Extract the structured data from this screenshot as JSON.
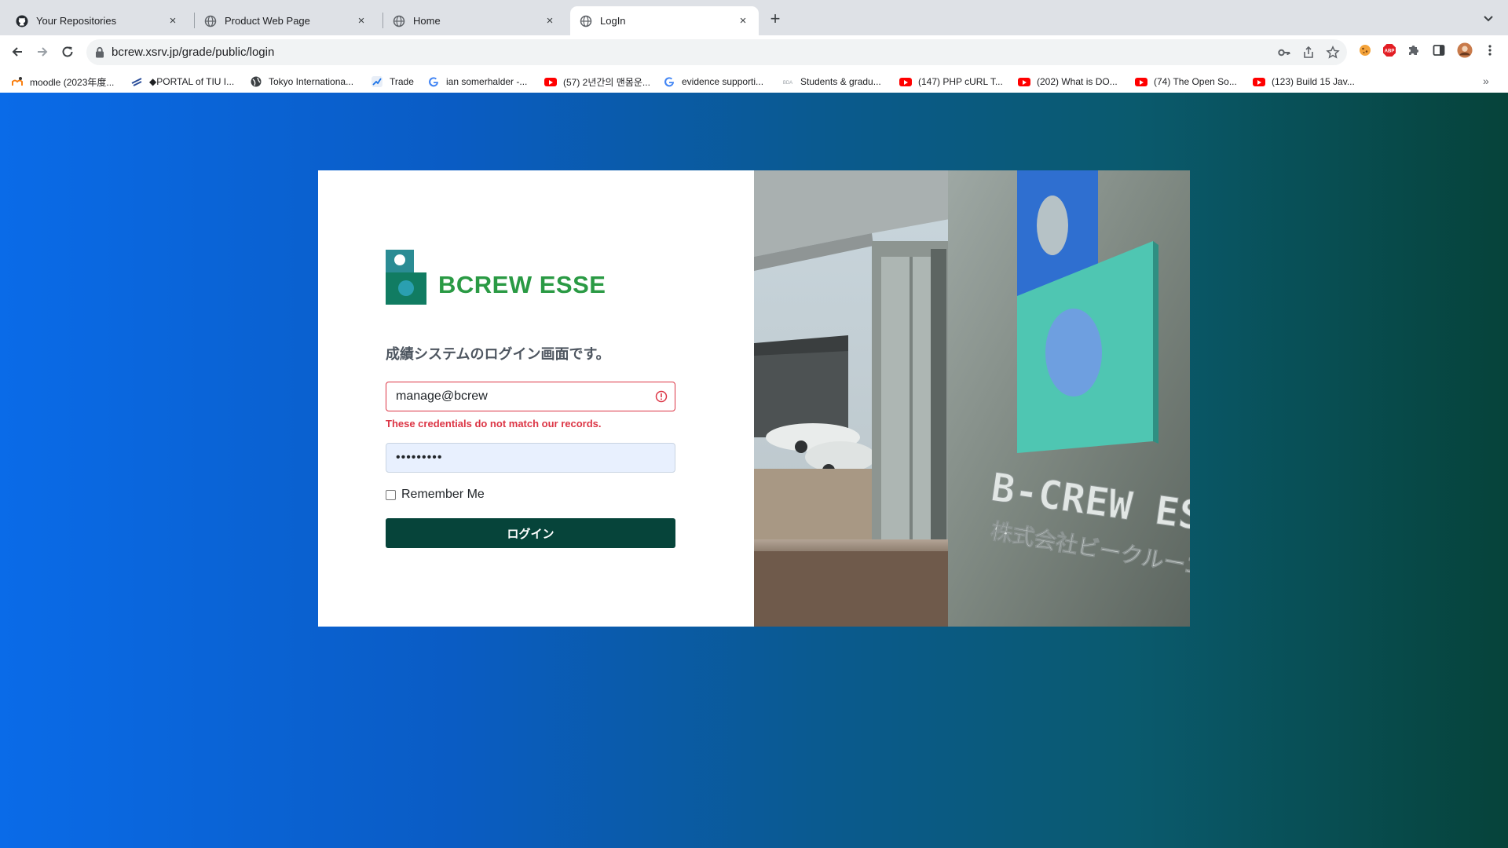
{
  "browser": {
    "tabs": [
      {
        "title": "Your Repositories",
        "icon": "github-icon"
      },
      {
        "title": "Product Web Page",
        "icon": "globe-icon"
      },
      {
        "title": "Home",
        "icon": "globe-icon"
      },
      {
        "title": "LogIn",
        "icon": "globe-icon"
      }
    ],
    "active_tab": 3,
    "address": "bcrew.xsrv.jp/grade/public/login",
    "bookmarks": [
      {
        "label": "moodle (2023年度...",
        "icon": "moodle-icon"
      },
      {
        "label": "◆PORTAL of TIU I...",
        "icon": "portal-icon"
      },
      {
        "label": "Tokyo Internationa...",
        "icon": "globe-icon"
      },
      {
        "label": "Trade",
        "icon": "trade-icon"
      },
      {
        "label": "ian somerhalder -...",
        "icon": "google-icon"
      },
      {
        "label": "(57) 2년간의 맨몸운...",
        "icon": "youtube-icon"
      },
      {
        "label": "evidence supporti...",
        "icon": "google-icon"
      },
      {
        "label": "Students & gradu...",
        "icon": "bda-icon"
      },
      {
        "label": "(147) PHP cURL T...",
        "icon": "youtube-icon"
      },
      {
        "label": "(202) What is DO...",
        "icon": "youtube-icon"
      },
      {
        "label": "(74) The Open So...",
        "icon": "youtube-icon"
      },
      {
        "label": "(123) Build 15 Jav...",
        "icon": "youtube-icon"
      }
    ],
    "more_bookmarks": "»"
  },
  "login": {
    "brand": "BCREW ESSE",
    "subtitle": "成績システムのログイン画面です。",
    "email_value": "manage@bcrew",
    "error_message": "These credentials do not match our records.",
    "password_mask": "•••••••••",
    "remember_label": "Remember Me",
    "submit_label": "ログイン"
  },
  "photo": {
    "sign_text": "B-CREW ESSE",
    "sign_subtext": "株式会社ビークルーエッセ"
  },
  "colors": {
    "brand_green": "#2a9a44",
    "button": "#06443a",
    "error": "#dc3545",
    "bg_start": "#0a6be8",
    "bg_end": "#06433a"
  }
}
